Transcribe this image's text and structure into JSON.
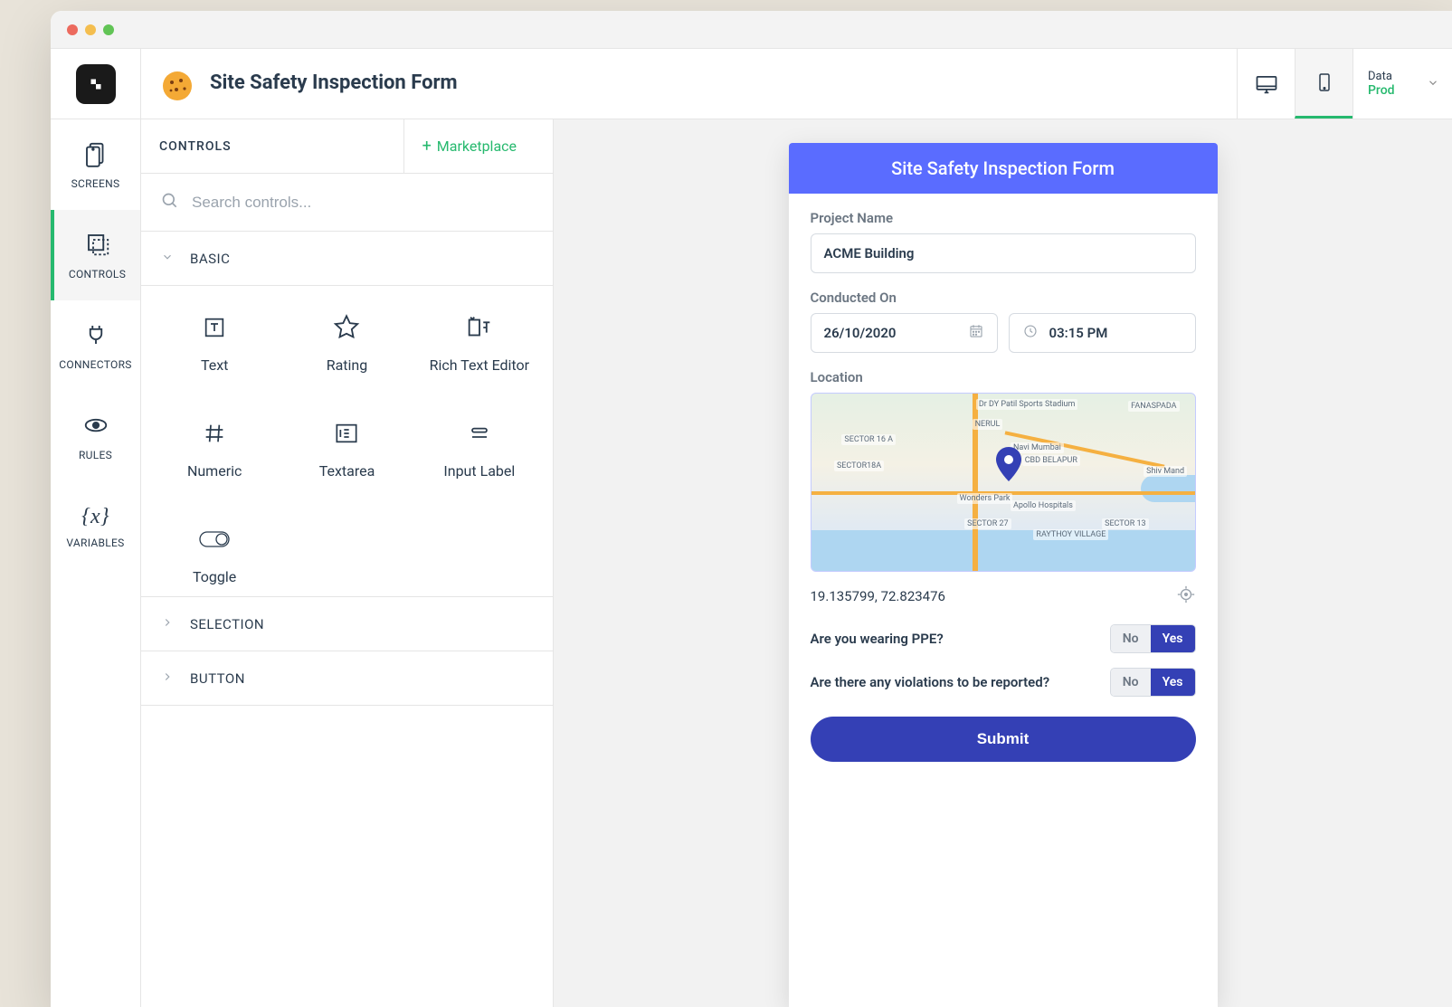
{
  "app_title": "Site Safety Inspection Form",
  "header": {
    "device_desktop": "desktop",
    "device_mobile": "mobile",
    "env_label": "Data",
    "env_value": "Prod"
  },
  "leftnav": [
    {
      "id": "screens",
      "label": "SCREENS"
    },
    {
      "id": "controls",
      "label": "CONTROLS"
    },
    {
      "id": "connectors",
      "label": "CONNECTORS"
    },
    {
      "id": "rules",
      "label": "RULES"
    },
    {
      "id": "variables",
      "label": "VARIABLES"
    }
  ],
  "panel": {
    "title": "CONTROLS",
    "marketplace": "Marketplace",
    "search_placeholder": "Search controls...",
    "sections": {
      "basic": {
        "title": "BASIC",
        "items": [
          {
            "id": "text",
            "label": "Text"
          },
          {
            "id": "rating",
            "label": "Rating"
          },
          {
            "id": "richtext",
            "label": "Rich Text Editor"
          },
          {
            "id": "numeric",
            "label": "Numeric"
          },
          {
            "id": "textarea",
            "label": "Textarea"
          },
          {
            "id": "inputlabel",
            "label": "Input Label"
          },
          {
            "id": "toggle",
            "label": "Toggle"
          }
        ]
      },
      "selection": {
        "title": "SELECTION"
      },
      "button": {
        "title": "BUTTON"
      }
    }
  },
  "preview": {
    "header": "Site Safety Inspection Form",
    "project_name_label": "Project Name",
    "project_name_value": "ACME Building",
    "conducted_on_label": "Conducted On",
    "date_value": "26/10/2020",
    "time_value": "03:15 PM",
    "location_label": "Location",
    "map_labels": [
      "NERUL",
      "CBD BELAPUR",
      "SECTOR 16 A",
      "SECTOR18A",
      "SECTOR 27",
      "SECTOR 13",
      "RAYTHOY VILLAGE",
      "FANASPADA",
      "Navi Mumbai",
      "Dr DY Patil Sports Stadium",
      "Apollo Hospitals",
      "Wonders Park",
      "Shiv Mand"
    ],
    "coords": "19.135799, 72.823476",
    "q1": "Are you wearing PPE?",
    "q2": "Are there any violations to be reported?",
    "no": "No",
    "yes": "Yes",
    "submit": "Submit"
  }
}
